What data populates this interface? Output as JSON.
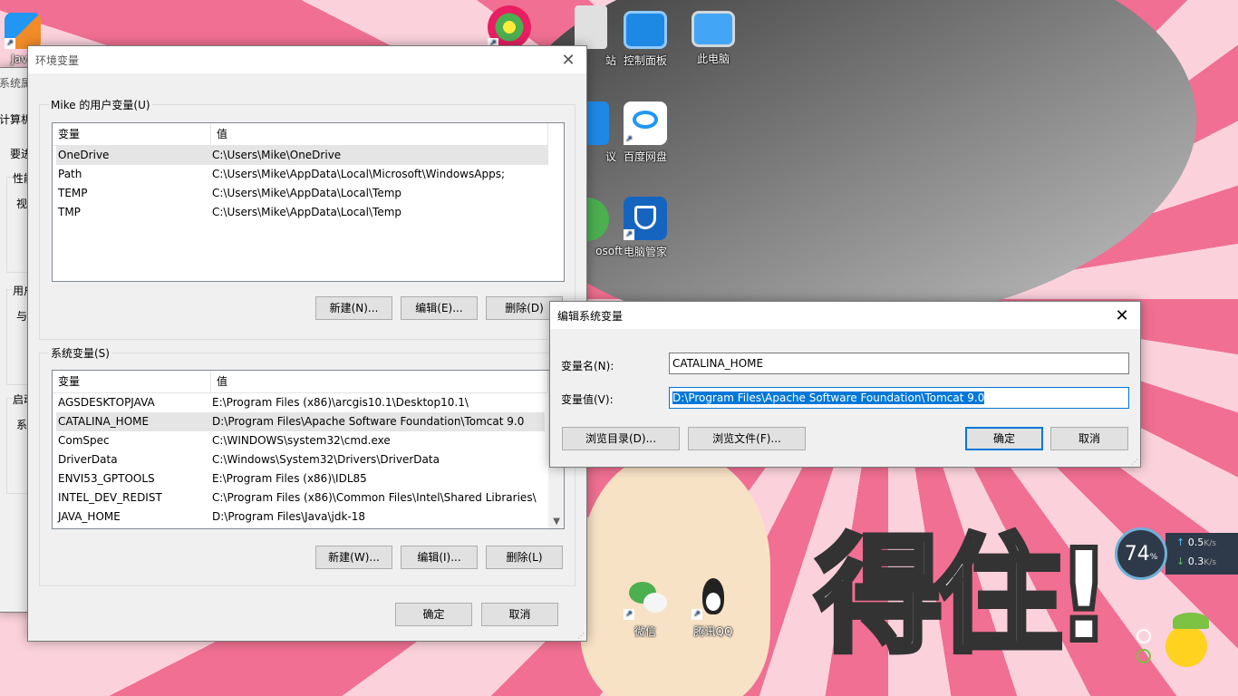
{
  "desktop": {
    "icons": [
      {
        "label": "Java",
        "color": "#f28c28"
      },
      {
        "label": "",
        "color": "#4caf50"
      },
      {
        "label": "站",
        "color": "#bdbdbd"
      },
      {
        "label": "控制面板",
        "color": "#1e88e5"
      },
      {
        "label": "此电脑",
        "color": "#42a5f5"
      },
      {
        "label": "议",
        "color": "#1e88e5"
      },
      {
        "label": "百度网盘",
        "color": "#ffffff"
      },
      {
        "label": "osoft",
        "color": "#4caf50"
      },
      {
        "label": "电脑管家",
        "color": "#1565c0"
      },
      {
        "label": "微信",
        "color": "#4caf50"
      },
      {
        "label": "腾讯QQ",
        "color": "#222222"
      }
    ],
    "wallpaper_text": "得住!"
  },
  "sysprops_partial": {
    "title": "系统属性",
    "tab": "计算机",
    "lines": [
      "要进",
      "性能",
      "视",
      "用户",
      "与",
      "启动",
      "系"
    ]
  },
  "env_window": {
    "title": "环境变量",
    "user_group_label": "Mike 的用户变量(U)",
    "columns": [
      "变量",
      "值"
    ],
    "user_vars": [
      {
        "name": "OneDrive",
        "value": "C:\\Users\\Mike\\OneDrive"
      },
      {
        "name": "Path",
        "value": "C:\\Users\\Mike\\AppData\\Local\\Microsoft\\WindowsApps;"
      },
      {
        "name": "TEMP",
        "value": "C:\\Users\\Mike\\AppData\\Local\\Temp"
      },
      {
        "name": "TMP",
        "value": "C:\\Users\\Mike\\AppData\\Local\\Temp"
      }
    ],
    "user_buttons": {
      "new": "新建(N)...",
      "edit": "编辑(E)...",
      "delete": "删除(D)"
    },
    "sys_group_label": "系统变量(S)",
    "sys_vars": [
      {
        "name": "AGSDESKTOPJAVA",
        "value": "E:\\Program Files (x86)\\arcgis10.1\\Desktop10.1\\"
      },
      {
        "name": "CATALINA_HOME",
        "value": "D:\\Program Files\\Apache Software Foundation\\Tomcat 9.0"
      },
      {
        "name": "ComSpec",
        "value": "C:\\WINDOWS\\system32\\cmd.exe"
      },
      {
        "name": "DriverData",
        "value": "C:\\Windows\\System32\\Drivers\\DriverData"
      },
      {
        "name": "ENVI53_GPTOOLS",
        "value": "E:\\Program Files (x86)\\IDL85"
      },
      {
        "name": "INTEL_DEV_REDIST",
        "value": "C:\\Program Files (x86)\\Common Files\\Intel\\Shared Libraries\\"
      },
      {
        "name": "JAVA_HOME",
        "value": "D:\\Program Files\\Java\\jdk-18"
      }
    ],
    "sys_buttons": {
      "new": "新建(W)...",
      "edit": "编辑(I)...",
      "delete": "删除(L)"
    },
    "ok": "确定",
    "cancel": "取消"
  },
  "edit_dialog": {
    "title": "编辑系统变量",
    "name_label": "变量名(N):",
    "name_value": "CATALINA_HOME",
    "value_label": "变量值(V):",
    "value_value": "D:\\Program Files\\Apache Software Foundation\\Tomcat 9.0",
    "browse_dir": "浏览目录(D)...",
    "browse_file": "浏览文件(F)...",
    "ok": "确定",
    "cancel": "取消"
  },
  "net_widget": {
    "percent": "74",
    "percent_unit": "%",
    "up": "0.5",
    "down": "0.3",
    "unit": "K/s"
  }
}
